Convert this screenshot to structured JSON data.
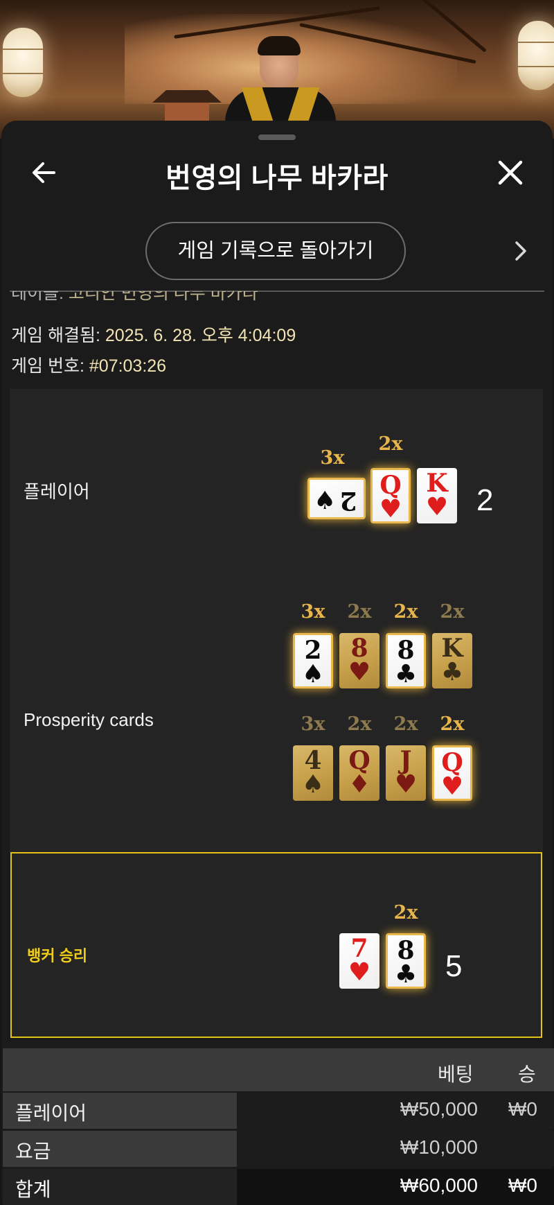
{
  "header": {
    "title": "번영의 나무 바카라",
    "history_button": "게임 기록으로 돌아가기"
  },
  "info": {
    "table_label": "테이블:",
    "table_value": "코리안 번영의 나무 바카라",
    "resolved_label": "게임 해결됨:",
    "resolved_value": "2025. 6. 28. 오후 4:04:09",
    "number_label": "게임 번호:",
    "number_value": "#07:03:26"
  },
  "player": {
    "label": "플레이어",
    "score": "2",
    "cards": [
      {
        "rank": "2",
        "suit": "♠",
        "color": "black",
        "mult": "3x",
        "orientation": "horizontal"
      },
      {
        "rank": "Q",
        "suit": "♥",
        "color": "red",
        "mult": "2x"
      },
      {
        "rank": "K",
        "suit": "♥",
        "color": "red",
        "mult": ""
      }
    ]
  },
  "prosperity": {
    "label": "Prosperity cards",
    "row1": [
      {
        "rank": "2",
        "suit": "♠",
        "color": "black",
        "mult": "3x",
        "active": true
      },
      {
        "rank": "8",
        "suit": "♥",
        "color": "red",
        "mult": "2x",
        "active": false
      },
      {
        "rank": "8",
        "suit": "♣",
        "color": "black",
        "mult": "2x",
        "active": true
      },
      {
        "rank": "K",
        "suit": "♣",
        "color": "black",
        "mult": "2x",
        "active": false
      }
    ],
    "row2": [
      {
        "rank": "4",
        "suit": "♠",
        "color": "black",
        "mult": "3x",
        "active": false
      },
      {
        "rank": "Q",
        "suit": "♦",
        "color": "red",
        "mult": "2x",
        "active": false
      },
      {
        "rank": "J",
        "suit": "♥",
        "color": "red",
        "mult": "2x",
        "active": false
      },
      {
        "rank": "Q",
        "suit": "♥",
        "color": "red",
        "mult": "2x",
        "active": true
      }
    ]
  },
  "banker": {
    "label": "뱅커 승리",
    "score": "5",
    "cards": [
      {
        "rank": "7",
        "suit": "♥",
        "color": "red",
        "mult": ""
      },
      {
        "rank": "8",
        "suit": "♣",
        "color": "black",
        "mult": "2x"
      }
    ]
  },
  "bets": {
    "col_bet": "베팅",
    "col_win": "승",
    "rows": [
      {
        "name": "플레이어",
        "bet": "₩50,000",
        "win": "₩0"
      },
      {
        "name": "요금",
        "bet": "₩10,000",
        "win": ""
      }
    ],
    "total": {
      "name": "합계",
      "bet": "₩60,000",
      "win": "₩0"
    }
  },
  "colors": {
    "accent_gold": "#e8b54b",
    "banker_border": "#e6c214",
    "info_value": "#f3e4b3"
  }
}
